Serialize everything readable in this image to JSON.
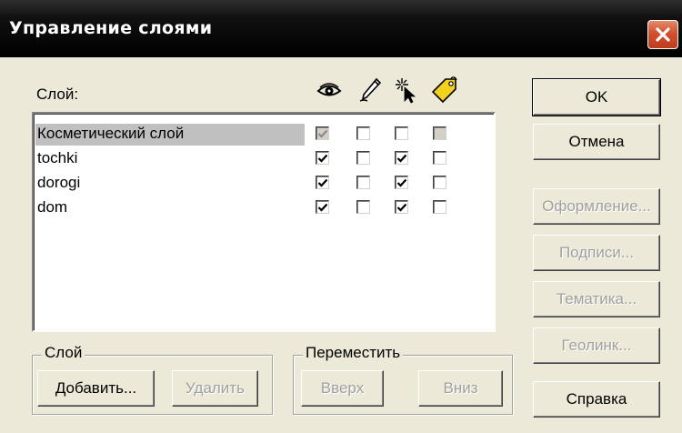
{
  "window": {
    "title": "Управление слоями"
  },
  "layer_list": {
    "label": "Слой:",
    "columns": [
      "eye-icon",
      "pencil-icon",
      "pointer-star-icon",
      "tag-icon"
    ],
    "rows": [
      {
        "name": "Косметический слой",
        "selected": true,
        "visible": true,
        "editable": false,
        "selectable": false,
        "labels": false
      },
      {
        "name": "tochki",
        "selected": false,
        "visible": true,
        "editable": false,
        "selectable": true,
        "labels": false
      },
      {
        "name": "dorogi",
        "selected": false,
        "visible": true,
        "editable": false,
        "selectable": true,
        "labels": false
      },
      {
        "name": "dom",
        "selected": false,
        "visible": true,
        "editable": false,
        "selectable": true,
        "labels": false
      }
    ]
  },
  "layer_group": {
    "title": "Слой",
    "add_label": "Добавить...",
    "delete_label": "Удалить"
  },
  "move_group": {
    "title": "Переместить",
    "up_label": "Вверх",
    "down_label": "Вниз"
  },
  "buttons": {
    "ok": "OK",
    "cancel": "Отмена",
    "style": "Оформление...",
    "labels": "Подписи...",
    "thematic": "Тематика...",
    "geolink": "Геолинк...",
    "help": "Справка"
  }
}
